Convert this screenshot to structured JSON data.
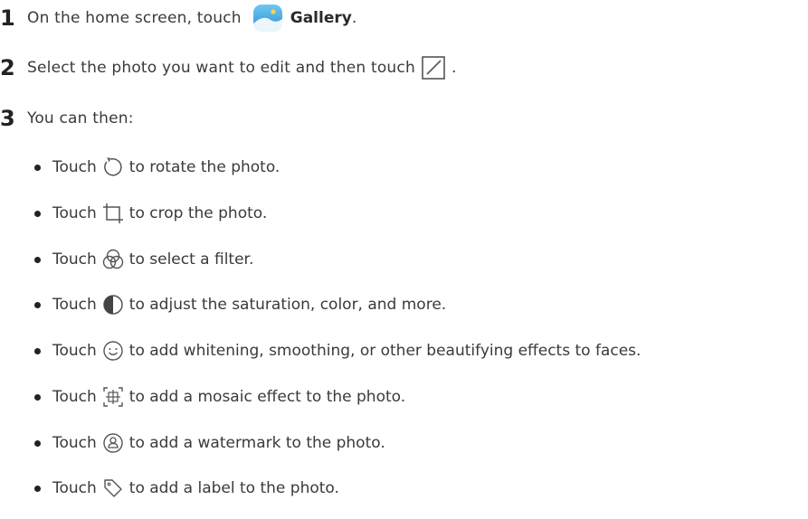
{
  "steps": [
    {
      "num": "1",
      "text_before": "On the home screen, touch ",
      "app_name": "Gallery",
      "text_after": ".",
      "icon": "gallery-app-icon"
    },
    {
      "num": "2",
      "text_before": "Select the photo you want to edit and then touch ",
      "text_after": ".",
      "icon": "edit-icon"
    },
    {
      "num": "3",
      "text": "You can then:"
    }
  ],
  "bullets": [
    {
      "touch": "Touch",
      "icon": "rotate-icon",
      "text": "to rotate the photo."
    },
    {
      "touch": "Touch",
      "icon": "crop-icon",
      "text": "to crop the photo."
    },
    {
      "touch": "Touch",
      "icon": "filter-icon",
      "text": "to select a filter."
    },
    {
      "touch": "Touch",
      "icon": "adjust-icon",
      "text": "to adjust the saturation, color, and more."
    },
    {
      "touch": "Touch",
      "icon": "beauty-face-icon",
      "text": "to add whitening, smoothing, or other beautifying effects to faces."
    },
    {
      "touch": "Touch",
      "icon": "mosaic-icon",
      "text": "to add a mosaic effect to the photo."
    },
    {
      "touch": "Touch",
      "icon": "watermark-icon",
      "text": "to add a watermark to the photo."
    },
    {
      "touch": "Touch",
      "icon": "label-icon",
      "text": "to add a label to the photo."
    }
  ],
  "colors": {
    "gallery_blue": "#3fa7e0",
    "text": "#3a3a3a",
    "icon_stroke": "#555555"
  }
}
